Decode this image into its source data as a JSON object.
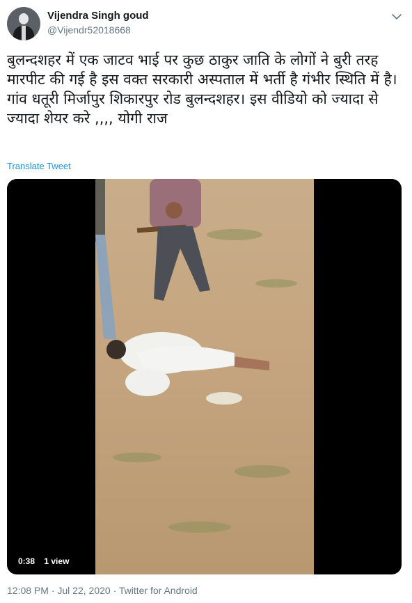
{
  "author": {
    "display_name": "Vijendra Singh goud",
    "handle": "@Vijendr52018668"
  },
  "tweet": {
    "text": "बुलन्दशहर में एक जाटव भाई पर कुछ ठाकुर जाति के लोगों ने बुरी तरह मारपीट की गई है इस वक्त सरकारी अस्पताल में भर्ती है गंभीर स्थिति में है। गांव धतूरी मिर्जापुर शिकारपुर रोड बुलन्दशहर। इस वीडियो को ज्यादा से ज्यादा शेयर करे ,,,, योगी राज",
    "translate_label": "Translate Tweet"
  },
  "video": {
    "duration": "0:38",
    "views": "1 view"
  },
  "meta": {
    "time": "12:08 PM",
    "date": "Jul 22, 2020",
    "separator": "·",
    "source": "Twitter for Android"
  },
  "icons": {
    "menu": "chevron-down-icon"
  },
  "colors": {
    "link": "#1b95e0",
    "secondary_text": "#657786"
  }
}
